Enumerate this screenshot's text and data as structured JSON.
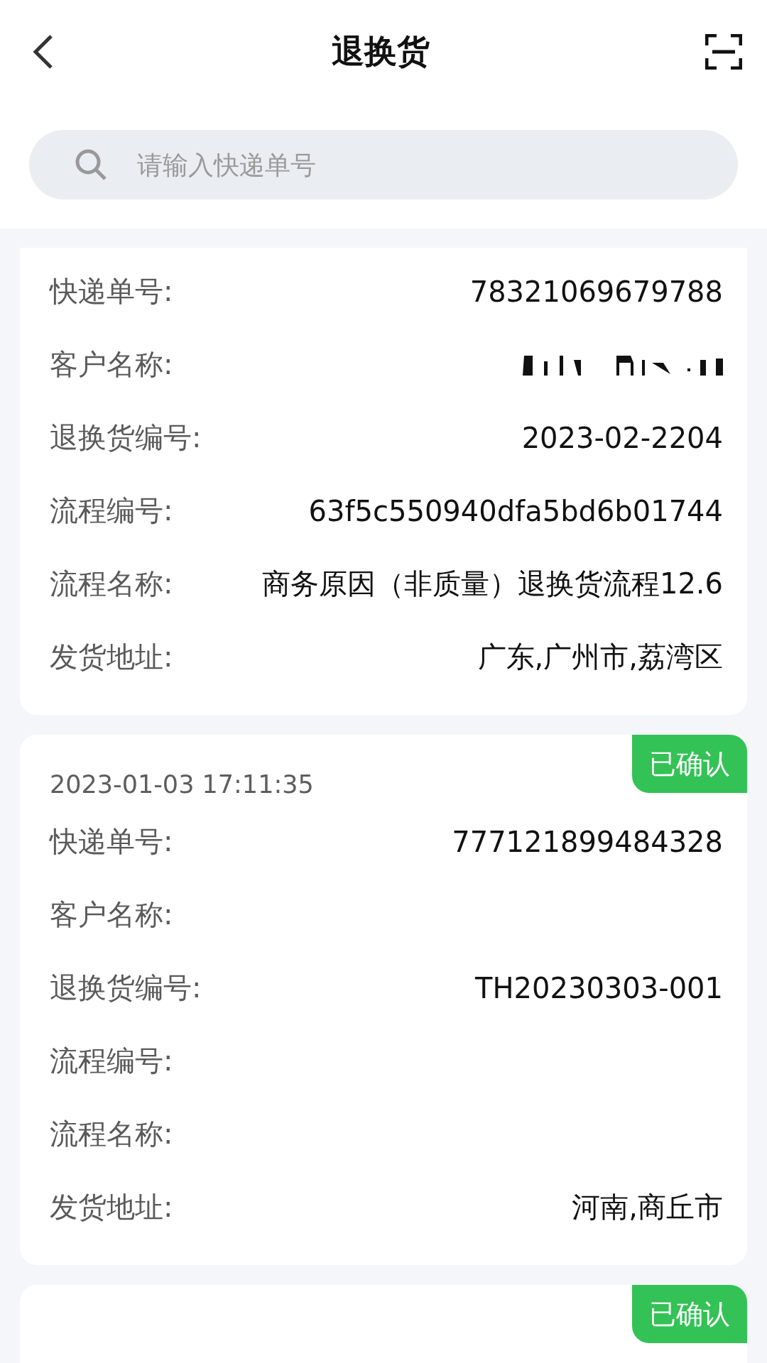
{
  "header": {
    "title": "退换货"
  },
  "search": {
    "placeholder": "请输入快递单号"
  },
  "cards": [
    {
      "cut_top": true,
      "rows": [
        {
          "label": "快递单号:",
          "value": "78321069679788"
        },
        {
          "label": "客户名称:",
          "redacted": true
        },
        {
          "label": "退换货编号:",
          "value": "2023-02-2204"
        },
        {
          "label": "流程编号:",
          "value": "63f5c550940dfa5bd6b01744"
        },
        {
          "label": "流程名称:",
          "value": "商务原因（非质量）退换货流程12.6"
        },
        {
          "label": "发货地址:",
          "value": "广东,广州市,荔湾区"
        }
      ]
    },
    {
      "status": "已确认",
      "time": "2023-01-03 17:11:35",
      "rows": [
        {
          "label": "快递单号:",
          "value": "777121899484328"
        },
        {
          "label": "客户名称:"
        },
        {
          "label": "退换货编号:",
          "value": "TH20230303-001"
        },
        {
          "label": "流程编号:"
        },
        {
          "label": "流程名称:"
        },
        {
          "label": "发货地址:",
          "value": "河南,商丘市"
        }
      ]
    },
    {
      "status": "已确认"
    }
  ]
}
